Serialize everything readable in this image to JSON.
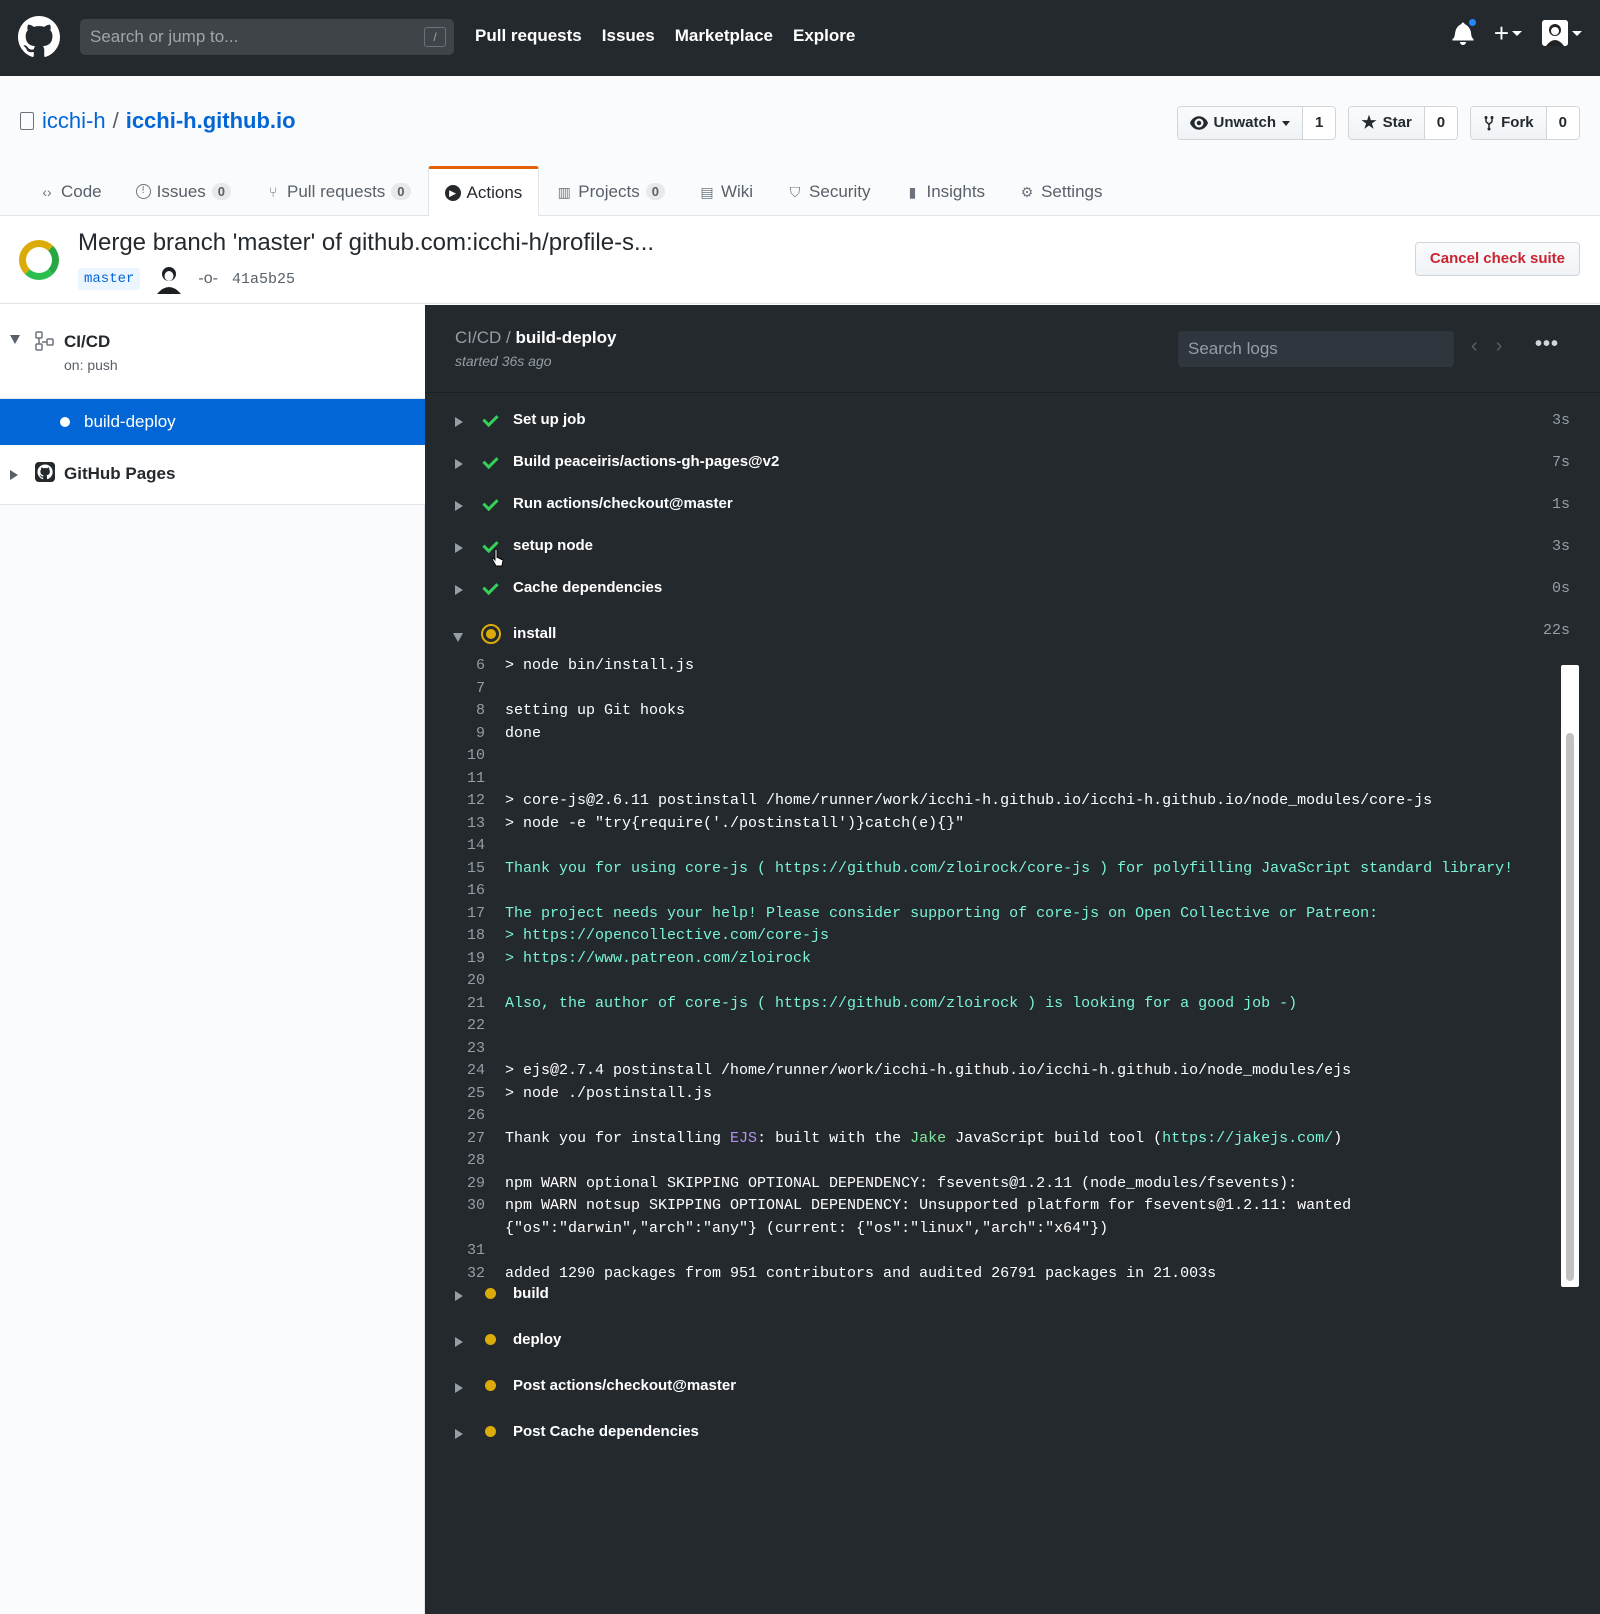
{
  "header": {
    "search_placeholder": "Search or jump to...",
    "search_key": "/",
    "nav": [
      "Pull requests",
      "Issues",
      "Marketplace",
      "Explore"
    ],
    "plus": "+"
  },
  "repo": {
    "owner": "icchi-h",
    "separator": "/",
    "name": "icchi-h.github.io",
    "watch_label": "Unwatch",
    "watch_count": "1",
    "star_label": "Star",
    "star_count": "0",
    "fork_label": "Fork",
    "fork_count": "0"
  },
  "tabs": [
    {
      "label": "Code",
      "icon": "code-icon",
      "counter": null
    },
    {
      "label": "Issues",
      "icon": "issue-icon",
      "counter": "0"
    },
    {
      "label": "Pull requests",
      "icon": "pull-request-icon",
      "counter": "0"
    },
    {
      "label": "Actions",
      "icon": "play-icon",
      "counter": null,
      "selected": true
    },
    {
      "label": "Projects",
      "icon": "project-icon",
      "counter": "0"
    },
    {
      "label": "Wiki",
      "icon": "book-icon",
      "counter": null
    },
    {
      "label": "Security",
      "icon": "shield-icon",
      "counter": null
    },
    {
      "label": "Insights",
      "icon": "graph-icon",
      "counter": null
    },
    {
      "label": "Settings",
      "icon": "gear-icon",
      "counter": null
    }
  ],
  "suite": {
    "title": "Merge branch 'master' of github.com:icchi-h/profile-s...",
    "branch": "master",
    "sha": "41a5b25",
    "cancel_label": "Cancel check suite"
  },
  "sidebar": {
    "workflow_name": "CI/CD",
    "workflow_trigger": "on: push",
    "job": "build-deploy",
    "pages": "GitHub Pages"
  },
  "log": {
    "workflow": "CI/CD",
    "separator": " / ",
    "job": "build-deploy",
    "started": "started 36s ago",
    "search_placeholder": "Search logs",
    "prev": "‹",
    "next": "›",
    "more": "•••",
    "steps_done": [
      {
        "name": "Set up job",
        "duration": "3s"
      },
      {
        "name": "Build peaceiris/actions-gh-pages@v2",
        "duration": "7s"
      },
      {
        "name": "Run actions/checkout@master",
        "duration": "1s"
      },
      {
        "name": "setup node",
        "duration": "3s"
      },
      {
        "name": "Cache dependencies",
        "duration": "0s"
      }
    ],
    "running_step": {
      "name": "install",
      "duration": "22s"
    },
    "lines": [
      {
        "n": "6",
        "t": "> node bin/install.js"
      },
      {
        "n": "7",
        "t": ""
      },
      {
        "n": "8",
        "t": "setting up Git hooks"
      },
      {
        "n": "9",
        "t": "done"
      },
      {
        "n": "10",
        "t": ""
      },
      {
        "n": "11",
        "t": ""
      },
      {
        "n": "12",
        "t": "> core-js@2.6.11 postinstall /home/runner/work/icchi-h.github.io/icchi-h.github.io/node_modules/core-js"
      },
      {
        "n": "13",
        "t": "> node -e \"try{require('./postinstall')}catch(e){}\""
      },
      {
        "n": "14",
        "t": ""
      },
      {
        "n": "15",
        "t": "Thank you for using core-js ( https://github.com/zloirock/core-js ) for polyfilling JavaScript standard library!",
        "cyan": true
      },
      {
        "n": "16",
        "t": ""
      },
      {
        "n": "17",
        "t": "The project needs your help! Please consider supporting of core-js on Open Collective or Patreon:",
        "cyan": true
      },
      {
        "n": "18",
        "t": "> https://opencollective.com/core-js",
        "cyan": true
      },
      {
        "n": "19",
        "t": "> https://www.patreon.com/zloirock",
        "cyan": true
      },
      {
        "n": "20",
        "t": ""
      },
      {
        "n": "21",
        "t": "Also, the author of core-js ( https://github.com/zloirock ) is looking for a good job -)",
        "cyan": true
      },
      {
        "n": "22",
        "t": ""
      },
      {
        "n": "23",
        "t": ""
      },
      {
        "n": "24",
        "t": "> ejs@2.7.4 postinstall /home/runner/work/icchi-h.github.io/icchi-h.github.io/node_modules/ejs"
      },
      {
        "n": "25",
        "t": "> node ./postinstall.js"
      },
      {
        "n": "26",
        "t": ""
      },
      {
        "n": "27",
        "t": "",
        "rich": true
      },
      {
        "n": "28",
        "t": ""
      },
      {
        "n": "29",
        "t": "npm WARN optional SKIPPING OPTIONAL DEPENDENCY: fsevents@1.2.11 (node_modules/fsevents):"
      },
      {
        "n": "30",
        "t": "npm WARN notsup SKIPPING OPTIONAL DEPENDENCY: Unsupported platform for fsevents@1.2.11: wanted\n{\"os\":\"darwin\",\"arch\":\"any\"} (current: {\"os\":\"linux\",\"arch\":\"x64\"})"
      },
      {
        "n": "31",
        "t": ""
      },
      {
        "n": "32",
        "t": "added 1290 packages from 951 contributors and audited 26791 packages in 21.003s"
      }
    ],
    "line27": {
      "a": "Thank you for installing ",
      "b": "EJS",
      "c": ": built with the ",
      "d": "Jake",
      "e": " JavaScript build tool (",
      "f": "https://jakejs.com/",
      "g": ")"
    },
    "steps_pending": [
      {
        "name": "build"
      },
      {
        "name": "deploy"
      },
      {
        "name": "Post actions/checkout@master"
      },
      {
        "name": "Post Cache dependencies"
      }
    ]
  },
  "colors": {
    "header_bg": "#24292e",
    "link": "#0366d6",
    "selected_tab_accent": "#e36209",
    "success": "#34d058",
    "pending": "#dbab09",
    "danger": "#cb2431",
    "log_bg": "#24292e",
    "log_highlight": "#79f4d7"
  }
}
